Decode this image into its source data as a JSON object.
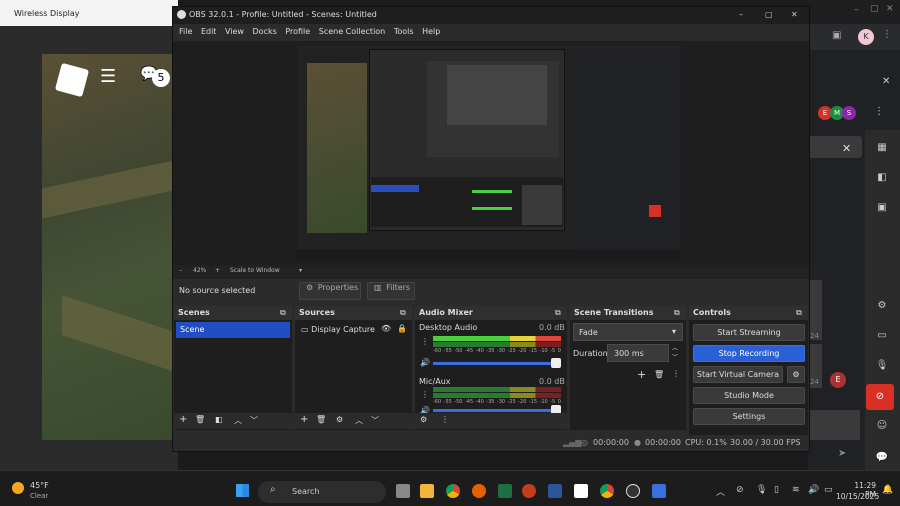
{
  "wireless_display": {
    "title": "Wireless Display",
    "badge": "5"
  },
  "browser": {
    "profile_initial": "K",
    "avatars": [
      "E",
      "M",
      "S"
    ],
    "avatar_colors": [
      "#d93025",
      "#1e8e3e",
      "#8e24aa"
    ],
    "side_badge": "E",
    "num1": "24",
    "num2": "24"
  },
  "obs": {
    "title": "OBS 32.0.1 - Profile: Untitled - Scenes: Untitled",
    "menu": [
      "File",
      "Edit",
      "View",
      "Docks",
      "Profile",
      "Scene Collection",
      "Tools",
      "Help"
    ],
    "zoom": "42%",
    "scale": "Scale to Window",
    "no_source": "No source selected",
    "properties": "Properties",
    "filters": "Filters",
    "panels": {
      "scenes": "Scenes",
      "sources": "Sources",
      "mixer": "Audio Mixer",
      "transitions": "Scene Transitions",
      "controls": "Controls"
    },
    "scene_item": "Scene",
    "source_item": "Display Capture",
    "mixer": [
      {
        "name": "Desktop Audio",
        "db": "0.0 dB"
      },
      {
        "name": "Mic/Aux",
        "db": "0.0 dB"
      }
    ],
    "meter_scale": [
      "-60",
      "-55",
      "-50",
      "-45",
      "-40",
      "-35",
      "-30",
      "-25",
      "-20",
      "-15",
      "-10",
      "-5",
      "0"
    ],
    "transition": "Fade",
    "duration_label": "Duration",
    "duration": "300 ms",
    "controls": [
      "Start Streaming",
      "Stop Recording",
      "Start Virtual Camera",
      "Studio Mode",
      "Settings"
    ],
    "status": {
      "stream_time": "00:00:00",
      "rec_time": "00:00:00",
      "cpu": "CPU: 0.1%",
      "fps": "30.00 / 30.00 FPS"
    }
  },
  "taskbar": {
    "temp": "45°F",
    "weather": "Clear",
    "search": "Search",
    "time": "11:29 PM",
    "date": "10/15/2025"
  }
}
